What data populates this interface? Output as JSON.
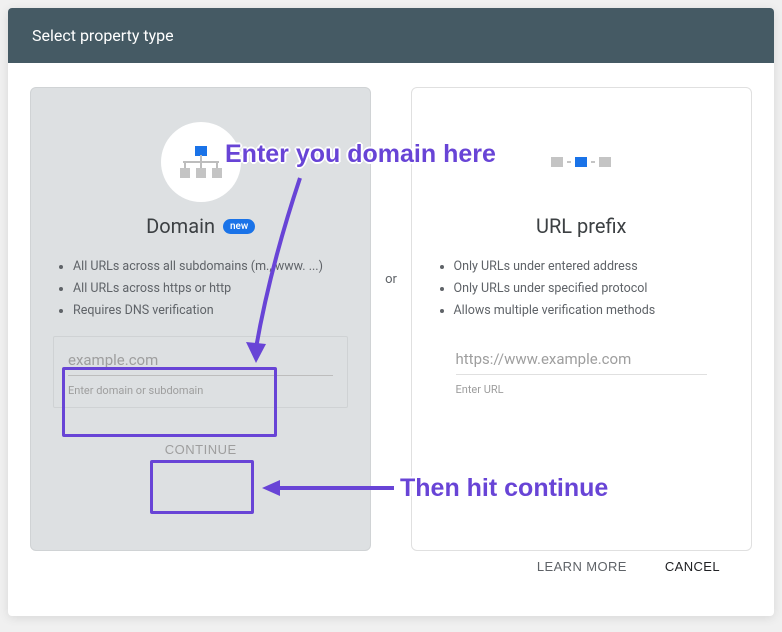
{
  "dialog": {
    "title": "Select property type",
    "separator": "or",
    "footer": {
      "learn_more": "LEARN MORE",
      "cancel": "CANCEL"
    }
  },
  "domain_card": {
    "title": "Domain",
    "badge": "new",
    "bullets": [
      "All URLs across all subdomains (m., www. ...)",
      "All URLs across https or http",
      "Requires DNS verification"
    ],
    "input_placeholder": "example.com",
    "input_helper": "Enter domain or subdomain",
    "continue": "CONTINUE"
  },
  "url_card": {
    "title": "URL prefix",
    "bullets": [
      "Only URLs under entered address",
      "Only URLs under specified protocol",
      "Allows multiple verification methods"
    ],
    "input_placeholder": "https://www.example.com",
    "input_helper": "Enter URL"
  },
  "annotations": {
    "enter_domain": "Enter you domain here",
    "hit_continue": "Then hit continue"
  }
}
